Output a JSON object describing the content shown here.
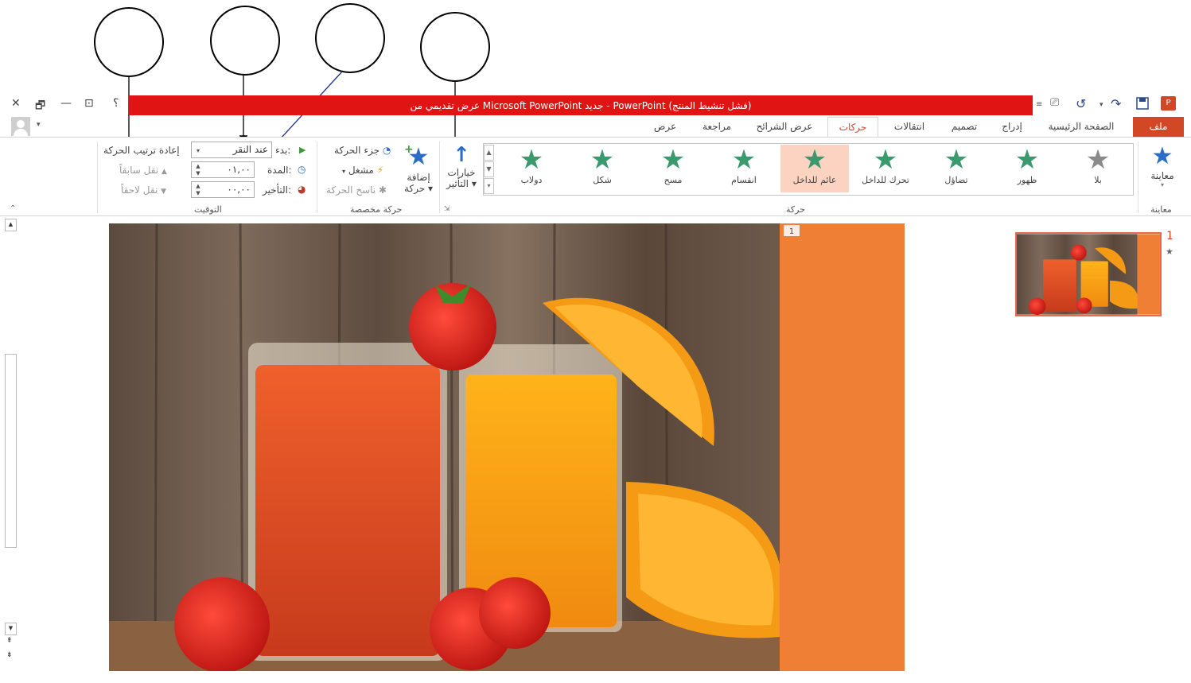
{
  "window": {
    "title": "عرض تقديمي من Microsoft PowerPoint جديد - PowerPoint (فشل تنشيط المنتج)",
    "help": "؟",
    "close": "✕",
    "restore": "🗗",
    "minimize": "—",
    "ribbon_display": "⊡"
  },
  "tabs": {
    "file": "ملف",
    "home": "الصفحة الرئيسية",
    "insert": "إدراج",
    "design": "تصميم",
    "transitions": "انتقالات",
    "animations": "حركات",
    "slideshow": "عرض الشرائح",
    "review": "مراجعة",
    "view": "عرض"
  },
  "ribbon": {
    "preview": {
      "label": "معاينة",
      "group": "معاينة"
    },
    "animation_group": "حركة",
    "animations": [
      {
        "label": "بلا",
        "color": "#8a8a8a"
      },
      {
        "label": "ظهور",
        "color": "#3a9a6e"
      },
      {
        "label": "تضاؤل",
        "color": "#3a9a6e"
      },
      {
        "label": "تحرك للداخل",
        "color": "#3a9a6e"
      },
      {
        "label": "عائم للداخل",
        "color": "#3a9a6e"
      },
      {
        "label": "انقسام",
        "color": "#3a9a6e"
      },
      {
        "label": "مسح",
        "color": "#3a9a6e"
      },
      {
        "label": "شكل",
        "color": "#3a9a6e"
      },
      {
        "label": "دولاب",
        "color": "#3a9a6e"
      }
    ],
    "effect_options": {
      "line1": "خيارات",
      "line2": "التأثير"
    },
    "advanced": {
      "group": "حركة مخصصة",
      "add_line1": "إضافة",
      "add_line2": "حركة",
      "pane": "جزء الحركة",
      "trigger": "مشغل",
      "painter": "ناسخ الحركة"
    },
    "timing": {
      "group": "التوقيت",
      "start_label": "بدء:",
      "start_value": "عند النقر",
      "duration_label": "المدة:",
      "duration_value": "٠١,٠٠",
      "delay_label": "التأخير:",
      "delay_value": "٠٠,٠٠",
      "reorder": "إعادة ترتيب الحركة",
      "move_earlier": "نقل سابقاً",
      "move_later": "نقل لاحقاً"
    }
  },
  "slide": {
    "number_badge": "1"
  },
  "thumbnails": [
    {
      "number": "1",
      "marker": "★"
    }
  ],
  "colors": {
    "accent": "#d24726",
    "titlebar": "#e11414",
    "slide_panel": "#ef7f35"
  }
}
